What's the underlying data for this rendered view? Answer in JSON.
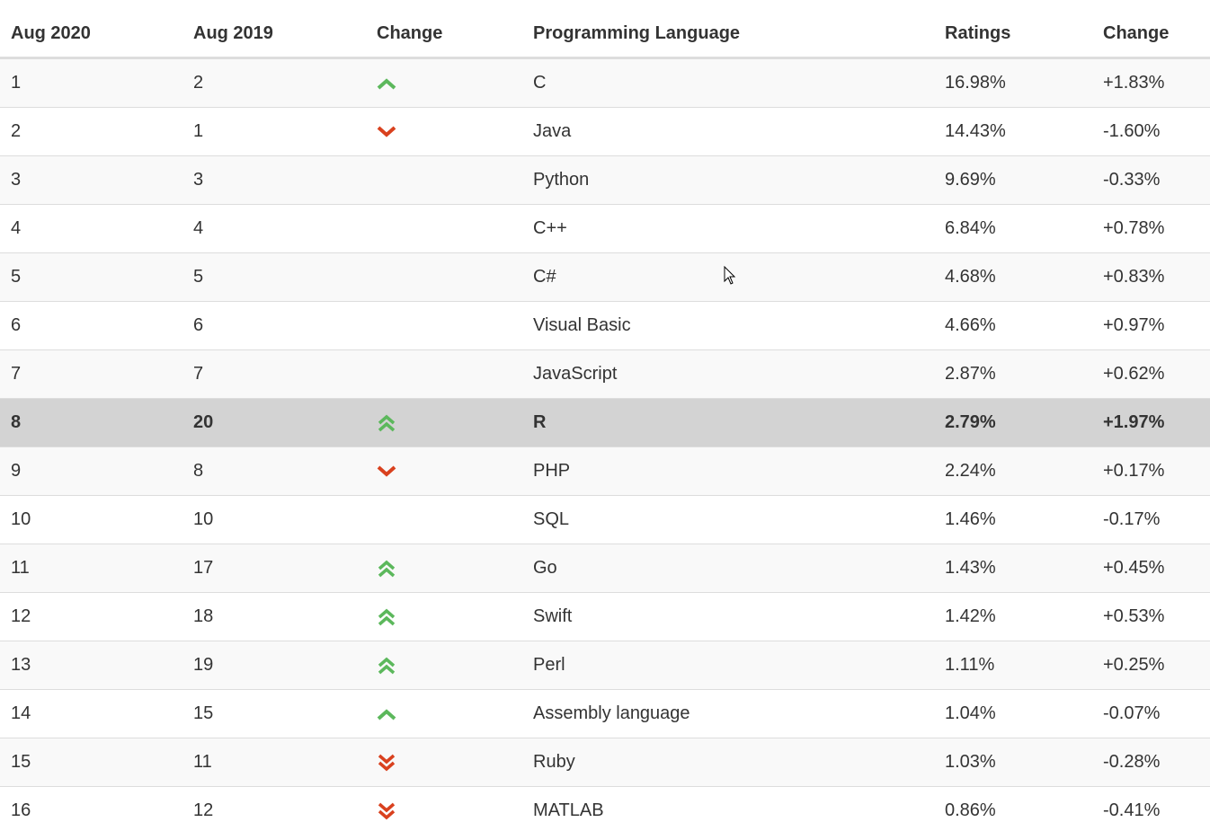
{
  "colors": {
    "up": "#5cb85c",
    "down": "#d9411e",
    "highlight_row": "#d3d3d3",
    "stripe": "#f9f9f9"
  },
  "headers": {
    "col1": "Aug 2020",
    "col2": "Aug 2019",
    "col3": "Change",
    "col4": "Programming Language",
    "col5": "Ratings",
    "col6": "Change"
  },
  "rows": [
    {
      "rank_2020": "1",
      "rank_2019": "2",
      "trend": "up",
      "language": "C",
      "rating": "16.98%",
      "change": "+1.83%"
    },
    {
      "rank_2020": "2",
      "rank_2019": "1",
      "trend": "down",
      "language": "Java",
      "rating": "14.43%",
      "change": "-1.60%"
    },
    {
      "rank_2020": "3",
      "rank_2019": "3",
      "trend": "none",
      "language": "Python",
      "rating": "9.69%",
      "change": "-0.33%"
    },
    {
      "rank_2020": "4",
      "rank_2019": "4",
      "trend": "none",
      "language": "C++",
      "rating": "6.84%",
      "change": "+0.78%"
    },
    {
      "rank_2020": "5",
      "rank_2019": "5",
      "trend": "none",
      "language": "C#",
      "rating": "4.68%",
      "change": "+0.83%"
    },
    {
      "rank_2020": "6",
      "rank_2019": "6",
      "trend": "none",
      "language": "Visual Basic",
      "rating": "4.66%",
      "change": "+0.97%"
    },
    {
      "rank_2020": "7",
      "rank_2019": "7",
      "trend": "none",
      "language": "JavaScript",
      "rating": "2.87%",
      "change": "+0.62%"
    },
    {
      "rank_2020": "8",
      "rank_2019": "20",
      "trend": "double-up",
      "language": "R",
      "rating": "2.79%",
      "change": "+1.97%",
      "highlight": true
    },
    {
      "rank_2020": "9",
      "rank_2019": "8",
      "trend": "down",
      "language": "PHP",
      "rating": "2.24%",
      "change": "+0.17%"
    },
    {
      "rank_2020": "10",
      "rank_2019": "10",
      "trend": "none",
      "language": "SQL",
      "rating": "1.46%",
      "change": "-0.17%"
    },
    {
      "rank_2020": "11",
      "rank_2019": "17",
      "trend": "double-up",
      "language": "Go",
      "rating": "1.43%",
      "change": "+0.45%"
    },
    {
      "rank_2020": "12",
      "rank_2019": "18",
      "trend": "double-up",
      "language": "Swift",
      "rating": "1.42%",
      "change": "+0.53%"
    },
    {
      "rank_2020": "13",
      "rank_2019": "19",
      "trend": "double-up",
      "language": "Perl",
      "rating": "1.11%",
      "change": "+0.25%"
    },
    {
      "rank_2020": "14",
      "rank_2019": "15",
      "trend": "up",
      "language": "Assembly language",
      "rating": "1.04%",
      "change": "-0.07%"
    },
    {
      "rank_2020": "15",
      "rank_2019": "11",
      "trend": "double-down",
      "language": "Ruby",
      "rating": "1.03%",
      "change": "-0.28%"
    },
    {
      "rank_2020": "16",
      "rank_2019": "12",
      "trend": "double-down",
      "language": "MATLAB",
      "rating": "0.86%",
      "change": "-0.41%"
    }
  ]
}
